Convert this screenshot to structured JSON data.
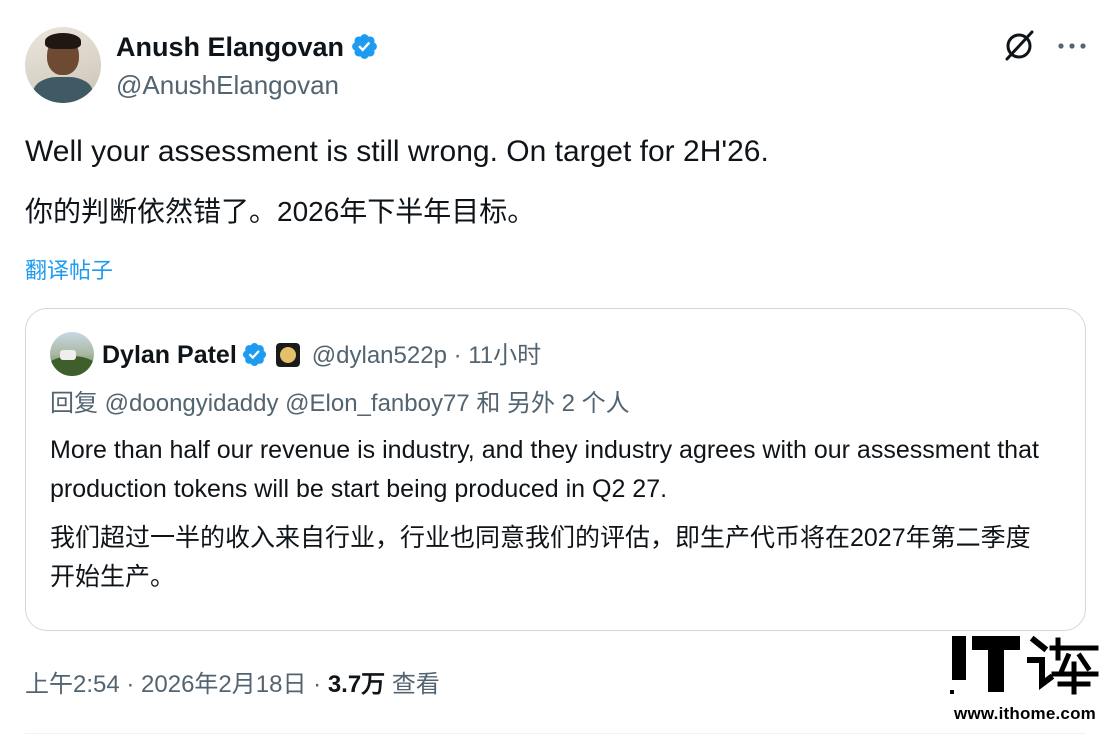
{
  "author": {
    "name": "Anush Elangovan",
    "handle": "@AnushElangovan"
  },
  "tweet": {
    "text": "Well your assessment is still wrong. On target for 2H'26.",
    "text_zh": "你的判断依然错了。2026年下半年目标。",
    "translate_label": "翻译帖子"
  },
  "quote": {
    "name": "Dylan Patel",
    "handle_time": "@dylan522p · 11小时",
    "reply_line": "回复 @doongyidaddy @Elon_fanboy77 和 另外 2 个人",
    "text": "More than half our revenue is industry, and they industry agrees with our assessment that production tokens will be start being produced in Q2 27.",
    "text_zh": "我们超过一半的收入来自行业，行业也同意我们的评估，即生产代币将在2027年第二季度开始生产。"
  },
  "meta": {
    "time_date": "上午2:54 · 2026年2月18日 · ",
    "views_count": "3.7万",
    "views_label": " 查看"
  },
  "watermark": {
    "logo_text": "IT之家",
    "url": "www.ithome.com"
  },
  "colors": {
    "accent": "#1d9bf0",
    "text": "#0f1419",
    "secondary": "#536471",
    "border": "#cfd9de"
  },
  "icons": {
    "verified": "verified-badge-icon",
    "grok": "grok-icon",
    "more": "more-dots-icon"
  }
}
